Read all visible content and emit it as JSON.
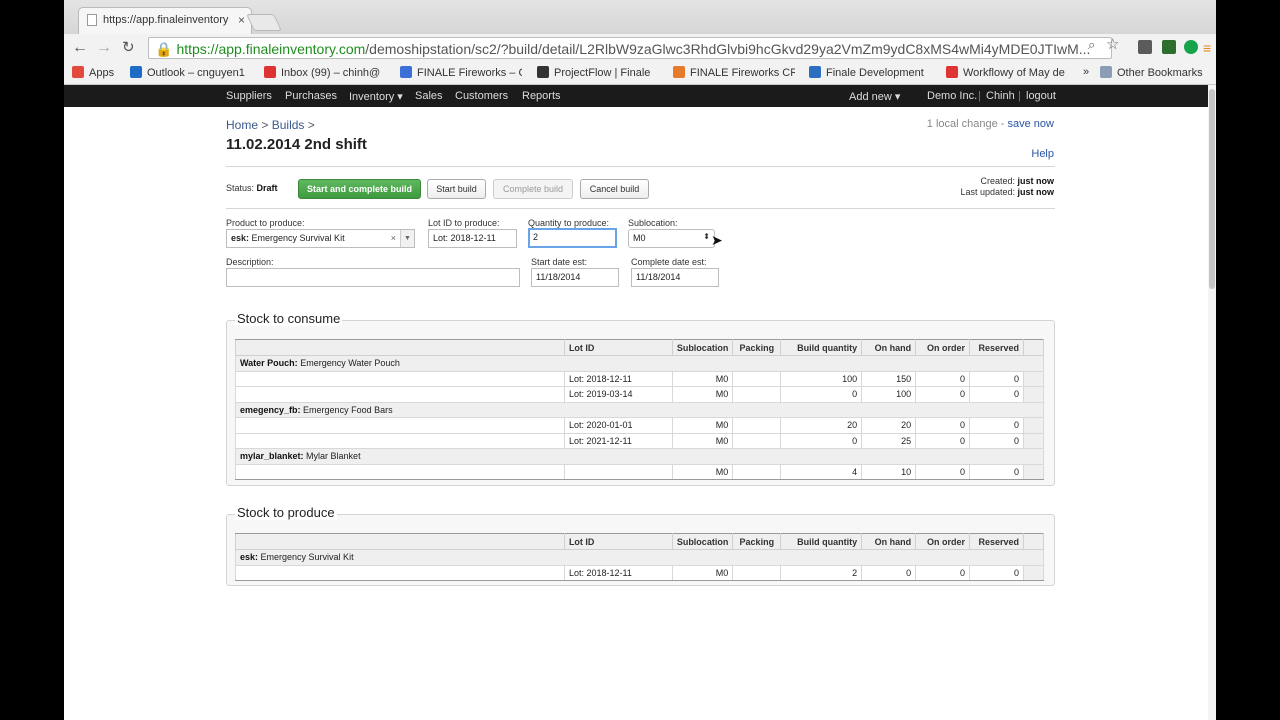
{
  "browser": {
    "tab_title": "https://app.finaleinventory",
    "tab_close": "×",
    "url_secure": "https://app.finaleinventory.com",
    "url_rest": "/demoshipstation/sc2/?build/detail/L2RlbW9zaGlwc3RhdGlvbi9hcGkvd29ya2VmZm9ydC8xMS4wMi4yMDE0JTIwM...",
    "bookmarks": [
      {
        "label": "Apps",
        "color": "#e04b3b"
      },
      {
        "label": "Outlook – cnguyen1",
        "color": "#1f6cc6"
      },
      {
        "label": "Inbox (99) – chinh@",
        "color": "#d33"
      },
      {
        "label": "FINALE Fireworks – C",
        "color": "#3b6ed6"
      },
      {
        "label": "ProjectFlow | Finale",
        "color": "#333"
      },
      {
        "label": "FINALE Fireworks CR",
        "color": "#e87a2b"
      },
      {
        "label": "Finale Development",
        "color": "#2a6fc0"
      },
      {
        "label": "Workflowy of May de",
        "color": "#d33"
      }
    ],
    "more_bookmarks": "»",
    "other_bookmarks": "Other Bookmarks"
  },
  "nav": {
    "items": [
      "Suppliers",
      "Purchases",
      "Inventory ▾",
      "Sales",
      "Customers",
      "Reports"
    ],
    "add_new": "Add new ▾",
    "company": "Demo Inc.",
    "user": "Chinh",
    "logout": "logout",
    "sep": "|"
  },
  "page": {
    "breadcrumb_home": "Home",
    "breadcrumb_sep1": ">",
    "breadcrumb_builds": "Builds",
    "breadcrumb_sep2": ">",
    "title": "11.02.2014 2nd shift",
    "local_change": "1 local change -",
    "save_now": "save now",
    "help": "Help"
  },
  "status": {
    "label": "Status:",
    "value": "Draft",
    "created_label": "Created:",
    "created_value": "just now",
    "updated_label": "Last updated:",
    "updated_value": "just now"
  },
  "actions": {
    "start_complete": "Start and complete build",
    "start": "Start build",
    "complete": "Complete build",
    "cancel": "Cancel build"
  },
  "form": {
    "product_label": "Product to produce:",
    "product_code": "esk:",
    "product_name": "Emergency Survival Kit",
    "clear": "×",
    "lot_label": "Lot ID to produce:",
    "lot_value": "Lot: 2018-12-11",
    "qty_label": "Quantity to produce:",
    "qty_value": "2",
    "subloc_label": "Sublocation:",
    "subloc_value": "M0",
    "desc_label": "Description:",
    "desc_value": "",
    "start_label": "Start date est:",
    "start_value": "11/18/2014",
    "complete_label": "Complete date est:",
    "complete_value": "11/18/2014"
  },
  "columns": [
    "Lot ID",
    "Sublocation",
    "Packing",
    "Build quantity",
    "On hand",
    "On order",
    "Reserved"
  ],
  "consume": {
    "title": "Stock to consume",
    "groups": [
      {
        "code": "Water Pouch:",
        "name": "Emergency Water Pouch",
        "rows": [
          {
            "lot": "Lot: 2018-12-11",
            "subloc": "M0",
            "packing": "",
            "build": "100",
            "onhand": "150",
            "onorder": "0",
            "reserved": "0"
          },
          {
            "lot": "Lot: 2019-03-14",
            "subloc": "M0",
            "packing": "",
            "build": "0",
            "onhand": "100",
            "onorder": "0",
            "reserved": "0"
          }
        ]
      },
      {
        "code": "emegency_fb:",
        "name": "Emergency Food Bars",
        "rows": [
          {
            "lot": "Lot: 2020-01-01",
            "subloc": "M0",
            "packing": "",
            "build": "20",
            "onhand": "20",
            "onorder": "0",
            "reserved": "0"
          },
          {
            "lot": "Lot: 2021-12-11",
            "subloc": "M0",
            "packing": "",
            "build": "0",
            "onhand": "25",
            "onorder": "0",
            "reserved": "0"
          }
        ]
      },
      {
        "code": "mylar_blanket:",
        "name": "Mylar Blanket",
        "rows": [
          {
            "lot": "",
            "subloc": "M0",
            "packing": "",
            "build": "4",
            "onhand": "10",
            "onorder": "0",
            "reserved": "0"
          }
        ]
      }
    ]
  },
  "produce": {
    "title": "Stock to produce",
    "groups": [
      {
        "code": "esk:",
        "name": "Emergency Survival Kit",
        "rows": [
          {
            "lot": "Lot: 2018-12-11",
            "subloc": "M0",
            "packing": "",
            "build": "2",
            "onhand": "0",
            "onorder": "0",
            "reserved": "0"
          }
        ]
      }
    ]
  }
}
